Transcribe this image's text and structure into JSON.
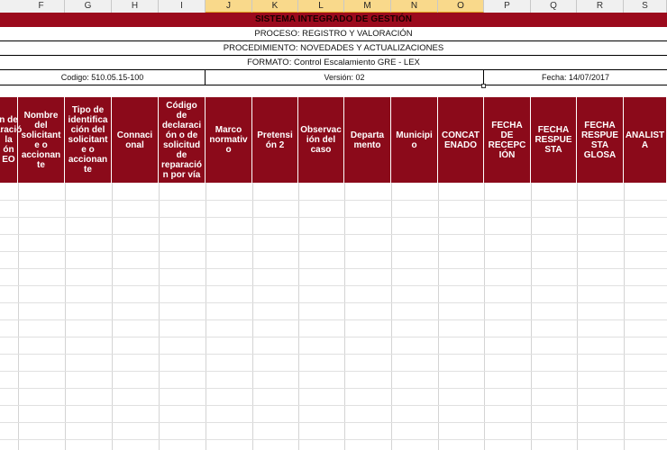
{
  "colors": {
    "title_band": "#9b0a1d",
    "header_fill": "#8b0a1a",
    "header_text": "#ffffff",
    "selected_column": "#f9d98b"
  },
  "columns": [
    {
      "letter": "F",
      "selected": false
    },
    {
      "letter": "G",
      "selected": false
    },
    {
      "letter": "H",
      "selected": false
    },
    {
      "letter": "I",
      "selected": false
    },
    {
      "letter": "J",
      "selected": true
    },
    {
      "letter": "K",
      "selected": true
    },
    {
      "letter": "L",
      "selected": true
    },
    {
      "letter": "M",
      "selected": true
    },
    {
      "letter": "N",
      "selected": true
    },
    {
      "letter": "O",
      "selected": true
    },
    {
      "letter": "P",
      "selected": false
    },
    {
      "letter": "Q",
      "selected": false
    },
    {
      "letter": "R",
      "selected": false
    },
    {
      "letter": "S",
      "selected": false
    }
  ],
  "document": {
    "title": "SISTEMA INTEGRADO DE GESTIÓN",
    "proceso": "PROCESO: REGISTRO Y VALORACIÓN",
    "procedimiento": "PROCEDIMIENTO: NOVEDADES Y ACTUALIZACIONES",
    "formato": "FORMATO: Control Escalamiento GRE - LEX",
    "codigo": "Codigo: 510.05.15-100",
    "version": "Versión: 02",
    "fecha": "Fecha: 14/07/2017"
  },
  "header_cells": [
    "n de\naració\nla\nón\nEO",
    "Nombre\ndel\nsolicitant\ne o\naccionan\nte",
    "Tipo de\nidentifica\nción del\nsolicitant\ne o\naccionan\nte",
    "Connaci\nonal",
    "Código\nde\ndeclaraci\nón o de\nsolicitud\nde\nreparació\nn por vía",
    "Marco\nnormativ\no",
    "Pretensi\nón 2",
    "Observac\nión del\ncaso",
    "Departa\nmento",
    "Municipi\no",
    "CONCAT\nENADO",
    "FECHA\nDE\nRECEPC\nIÓN",
    "FECHA\nRESPUE\nSTA",
    "FECHA\nRESPUE\nSTA\nGLOSA",
    "ANALIST\nA"
  ]
}
